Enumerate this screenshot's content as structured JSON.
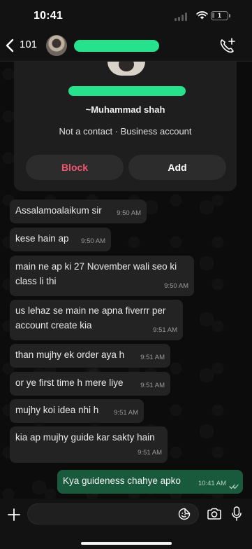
{
  "status_bar": {
    "time": "10:41",
    "battery": "1"
  },
  "header": {
    "back_count": "101",
    "icons": [
      "chevron-left-icon",
      "add-call-icon"
    ]
  },
  "profile_card": {
    "handle": "~Muhammad shah",
    "status": "Not a contact · Business account",
    "block_label": "Block",
    "add_label": "Add"
  },
  "messages": [
    {
      "text": "Assalamoalaikum sir",
      "time": "9:50 AM",
      "direction": "in"
    },
    {
      "text": "kese hain ap",
      "time": "9:50 AM",
      "direction": "in"
    },
    {
      "text": "main ne ap ki 27 November wali seo ki class li thi",
      "time": "9:50 AM",
      "direction": "in"
    },
    {
      "text": "us lehaz se main ne apna fiverrr per account create kia",
      "time": "9:51 AM",
      "direction": "in"
    },
    {
      "text": "than mujhy ek order aya h",
      "time": "9:51 AM",
      "direction": "in"
    },
    {
      "text": "or ye first time h mere liye",
      "time": "9:51 AM",
      "direction": "in"
    },
    {
      "text": "mujhy koi idea nhi h",
      "time": "9:51 AM",
      "direction": "in"
    },
    {
      "text": "kia ap mujhy guide kar sakty hain",
      "time": "9:51 AM",
      "direction": "in"
    },
    {
      "text": "Kya guideness chahye apko",
      "time": "10:41 AM",
      "direction": "out"
    }
  ],
  "input_bar": {
    "placeholder": "",
    "icons": [
      "plus-icon",
      "sticker-icon",
      "camera-icon",
      "microphone-icon"
    ]
  },
  "colors": {
    "background": "#0b0b0b",
    "incoming_bubble": "#232323",
    "outgoing_bubble": "#1a5a3c",
    "block_text": "#f2556e",
    "redaction": "#27e28c"
  }
}
